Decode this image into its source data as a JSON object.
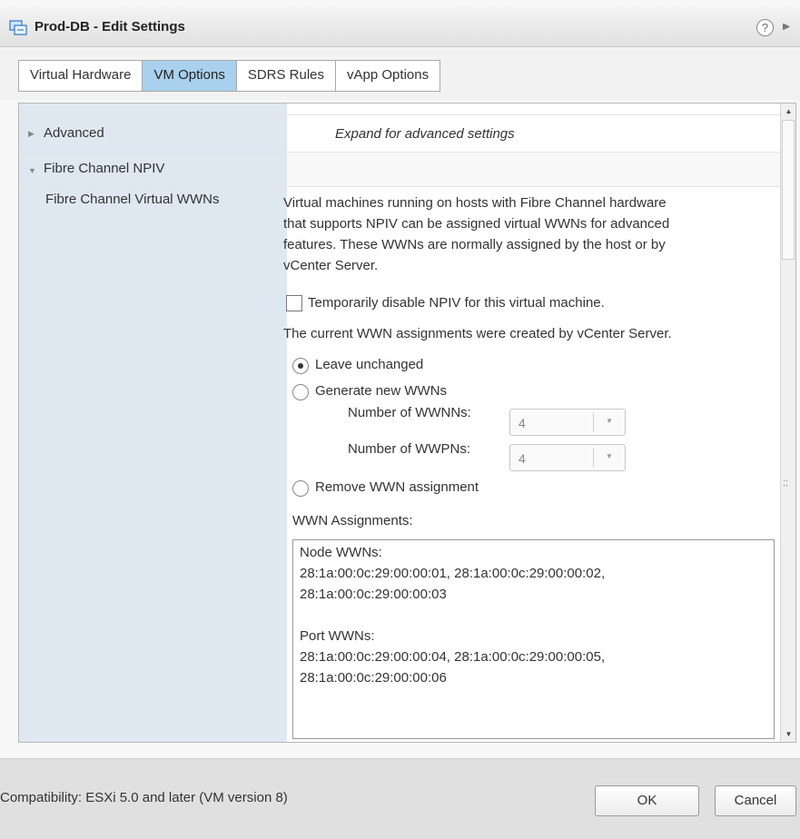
{
  "window": {
    "title": "Prod-DB - Edit Settings",
    "help_icon": "?",
    "expand_icon": "▸▸"
  },
  "tabs": [
    {
      "label": "Virtual Hardware",
      "active": false
    },
    {
      "label": "VM Options",
      "active": true
    },
    {
      "label": "SDRS Rules",
      "active": false
    },
    {
      "label": "vApp Options",
      "active": false
    }
  ],
  "settings": {
    "advanced": {
      "label": "Advanced",
      "description": "Expand for advanced settings"
    },
    "fibre_channel": {
      "label": "Fibre Channel NPIV",
      "virtual_wwns_label": "Fibre Channel Virtual WWNs",
      "description_lines": [
        "Virtual machines running on hosts with Fibre Channel hardware",
        "that supports NPIV can be assigned virtual WWNs for advanced",
        "features. These WWNs are normally assigned by the host or by",
        "vCenter Server."
      ],
      "disable_npiv_label": "Temporarily disable NPIV for this virtual machine.",
      "disable_npiv_checked": false,
      "current_assignment_text": "The current WWN assignments were created by vCenter Server.",
      "options": {
        "leave_unchanged": "Leave unchanged",
        "generate_new": "Generate new WWNs",
        "remove": "Remove WWN assignment",
        "selected": "leave_unchanged"
      },
      "num_wwnns_label": "Number of WWNNs:",
      "num_wwnns_value": "4",
      "num_wwpns_label": "Number of WWPNs:",
      "num_wwpns_value": "4",
      "assignments_label": "WWN Assignments:",
      "assignments": {
        "node_header": "Node WWNs:",
        "node_line1": "28:1a:00:0c:29:00:00:01, 28:1a:00:0c:29:00:00:02,",
        "node_line2": "28:1a:00:0c:29:00:00:03",
        "port_header": "Port WWNs:",
        "port_line1": "28:1a:00:0c:29:00:00:04, 28:1a:00:0c:29:00:00:05,",
        "port_line2": "28:1a:00:0c:29:00:00:06"
      }
    }
  },
  "footer": {
    "compatibility": "Compatibility: ESXi 5.0 and later (VM version 8)",
    "ok_label": "OK",
    "cancel_label": "Cancel"
  },
  "colors": {
    "active_tab": "#a9d0ec",
    "left_column": "#dfe8f1",
    "footer": "#e0e0e0"
  }
}
